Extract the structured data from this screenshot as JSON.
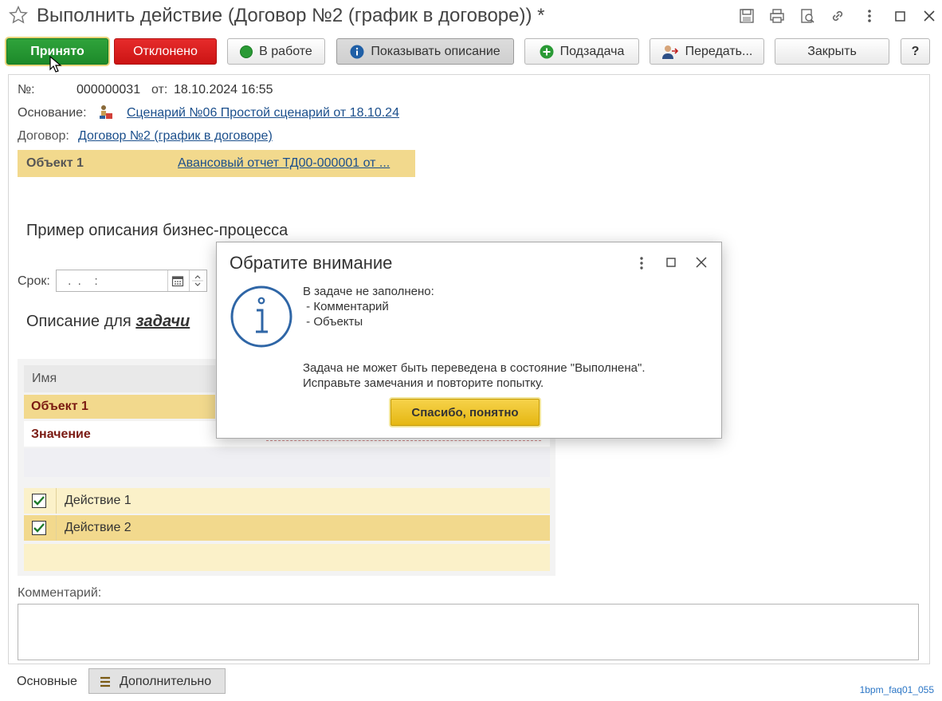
{
  "window": {
    "title": "Выполнить действие (Договор №2 (график в договоре)) *"
  },
  "toolbar": {
    "accept_label": "Принято",
    "reject_label": "Отклонено",
    "in_work_label": "В работе",
    "show_description_label": "Показывать описание",
    "subtask_label": "Подзадача",
    "transfer_label": "Передать...",
    "close_label": "Закрыть",
    "help_label": "?"
  },
  "form": {
    "number_label": "№:",
    "number_value": "000000031",
    "date_label": "от:",
    "date_value": "18.10.2024 16:55",
    "basis_label": "Основание:",
    "basis_link": "Сценарий №06 Простой сценарий от 18.10.24",
    "contract_label": "Договор:",
    "contract_link": "Договор №2 (график в договоре)",
    "object_label": "Объект 1",
    "object_link": "Авансовый отчет ТД00-000001 от ...",
    "process_description": "Пример описания бизнес-процесса",
    "deadline_label": "Срок:",
    "deadline_value": " .  .    :",
    "task_description_prefix": "Описание для ",
    "task_description_em": "задачи",
    "table": {
      "header_name": "Имя",
      "row_object": "Объект 1",
      "row_value": "Значение"
    },
    "actions": [
      {
        "label": "Действие 1",
        "checked": true
      },
      {
        "label": "Действие 2",
        "checked": true
      }
    ],
    "comment_label": "Комментарий:"
  },
  "tabs": {
    "main": "Основные",
    "extra": "Дополнительно"
  },
  "dialog": {
    "title": "Обратите внимание",
    "line1": "В задаче не заполнено:",
    "line2": " - Комментарий",
    "line3": " - Объекты",
    "line4": "Задача не может быть переведена в состояние \"Выполнена\".",
    "line5": "Исправьте замечания и повторите попытку.",
    "ok_label": "Спасибо, понятно"
  },
  "watermark": "1bpm_faq01_055",
  "colors": {
    "accept": "#1d8a2a",
    "reject": "#cc1414",
    "highlight": "#f2d98d",
    "link": "#1b4f8c",
    "dialog_button": "#e5b712"
  }
}
